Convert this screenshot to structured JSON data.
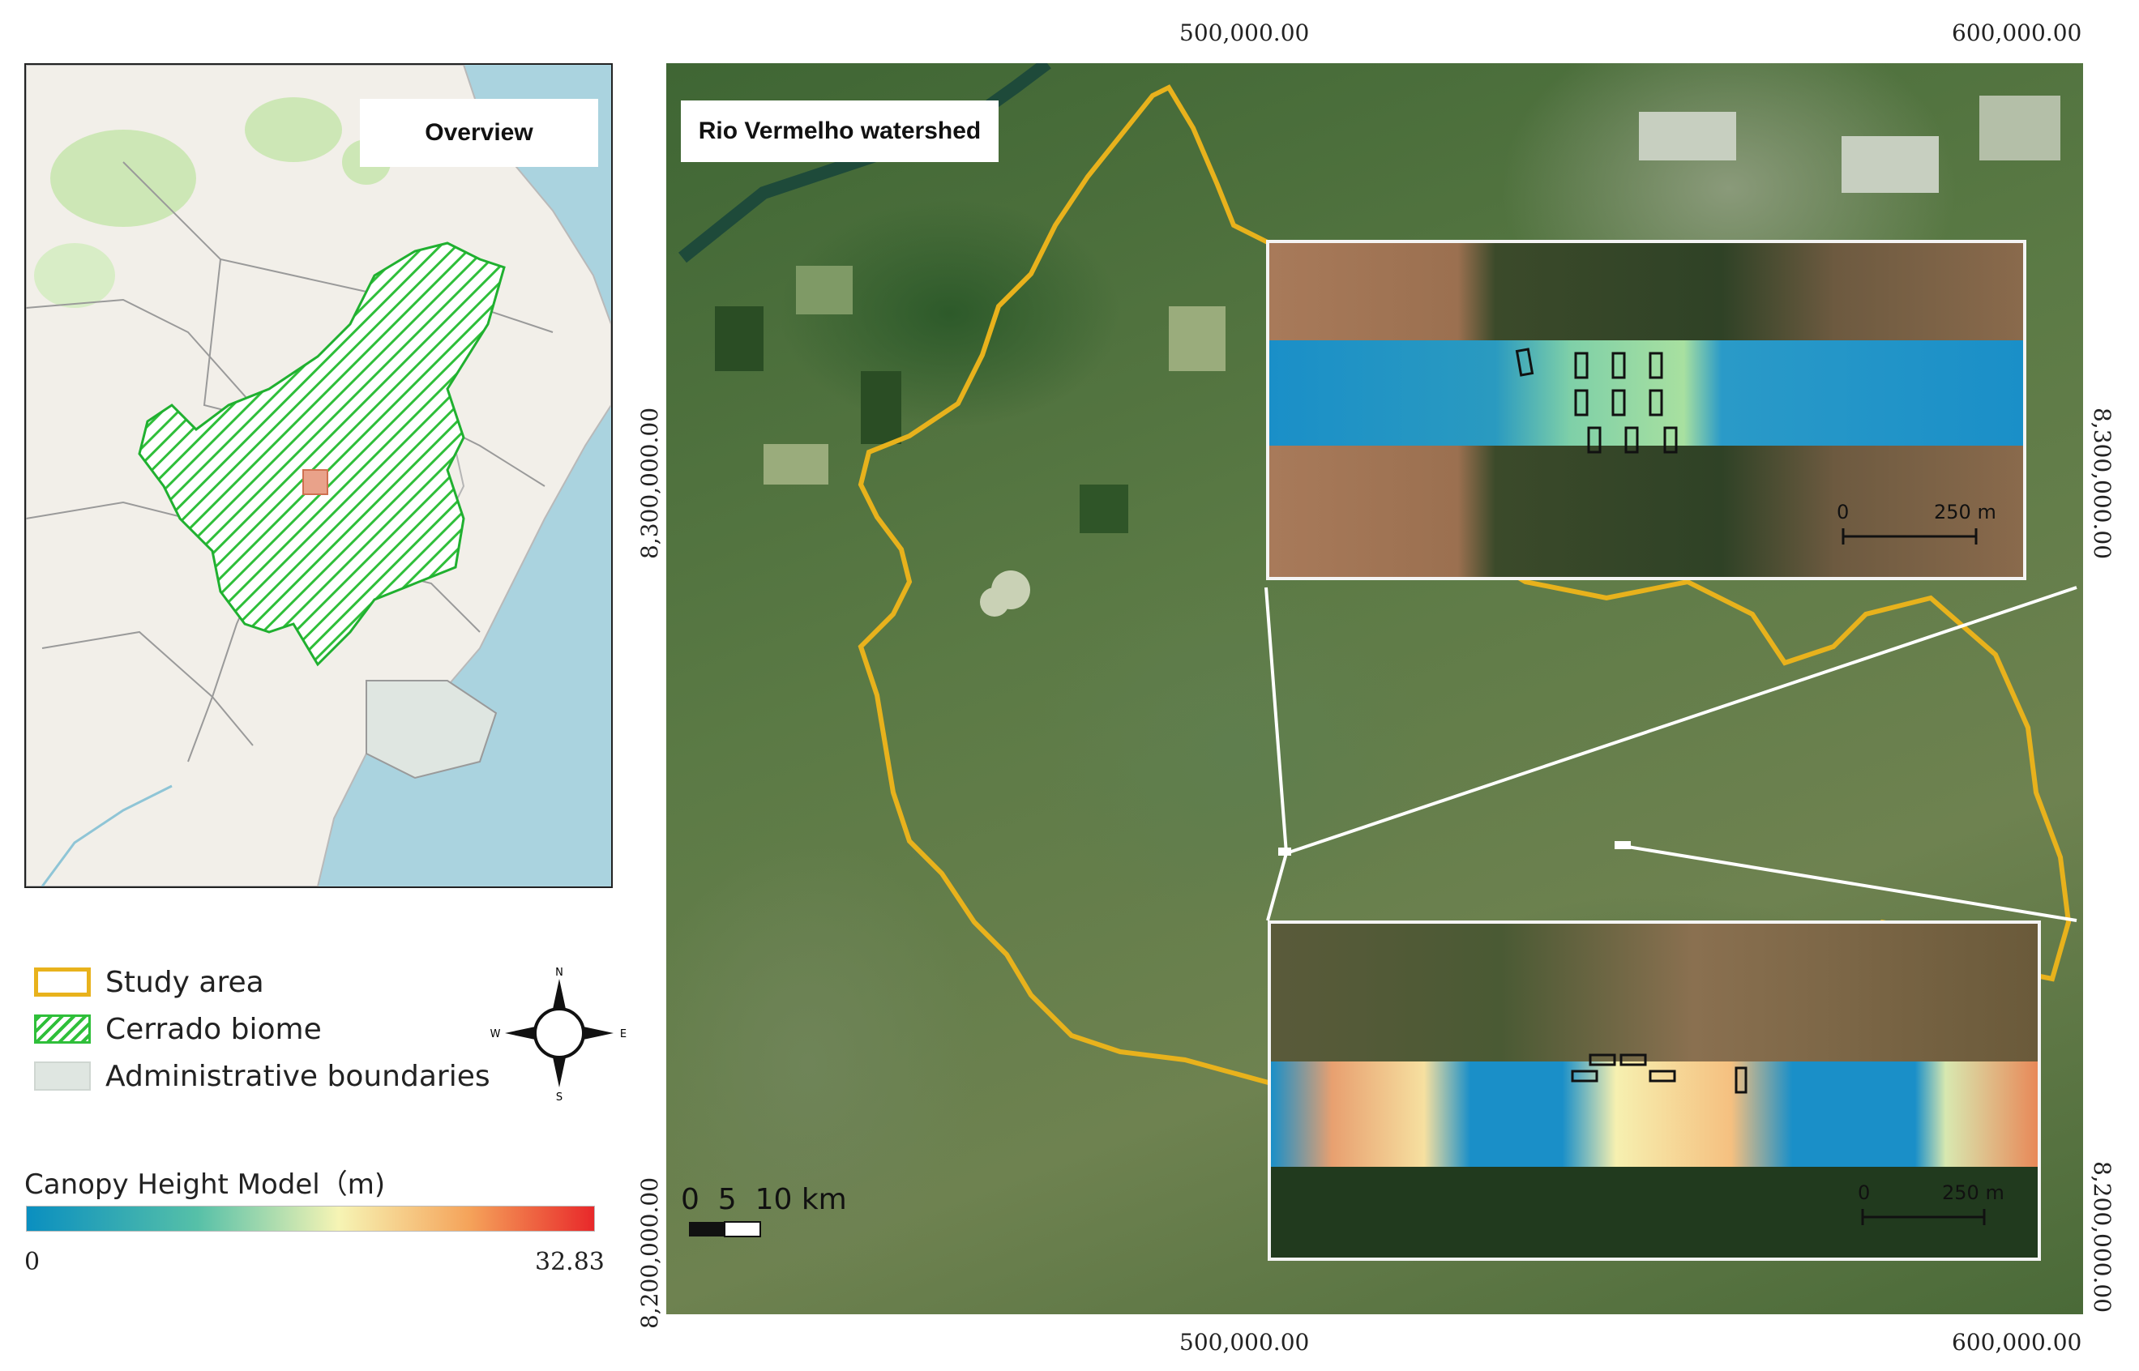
{
  "overview": {
    "title": "Overview"
  },
  "main_map": {
    "title": "Rio Vermelho watershed",
    "top_coords": [
      "500,000.00",
      "600,000.00"
    ],
    "bottom_coords": [
      "500,000.00",
      "600,000.00"
    ],
    "left_coords": [
      "8,300,000.00",
      "8,200,000.00"
    ],
    "right_coords": [
      "8,300,000.00",
      "8,200,000.00"
    ],
    "scalebar_label": "0  5  10 km"
  },
  "insets": [
    {
      "scale_zero": "0",
      "scale_label": "250 m"
    },
    {
      "scale_zero": "0",
      "scale_label": "250 m"
    }
  ],
  "legend": {
    "items": [
      {
        "label": "Study area",
        "color": "#e8b21c"
      },
      {
        "label": "Cerrado biome",
        "color": "#2fbf3a"
      },
      {
        "label": "Administrative boundaries",
        "color": "#dfe6e1"
      }
    ],
    "compass": {
      "n": "N",
      "s": "S",
      "e": "E",
      "w": "W"
    }
  },
  "colorbar": {
    "title": "Canopy Height Model（m)",
    "min": "0",
    "max": "32.83",
    "colors": [
      "#0a8fc0",
      "#56c0a8",
      "#f6f4b4",
      "#f5a35a",
      "#e8282a"
    ]
  }
}
